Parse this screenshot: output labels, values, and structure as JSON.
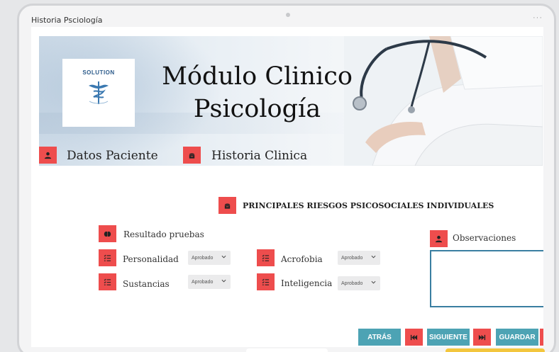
{
  "window": {
    "title": "Historia Psciología",
    "more": "···"
  },
  "banner": {
    "logo_text": "SOLUTION",
    "title_line1": "Módulo Clinico",
    "title_line2": "Psicología"
  },
  "nav": {
    "datos_paciente": "Datos Paciente",
    "historia_clinica": "Historia Clinica"
  },
  "section": {
    "title": "PRINCIPALES RIESGOS PSICOSOCIALES INDIVIDUALES"
  },
  "form": {
    "resultado_pruebas": "Resultado pruebas",
    "fields": [
      {
        "label": "Personalidad",
        "value": "Aprobado"
      },
      {
        "label": "Sustancias",
        "value": "Aprobado"
      },
      {
        "label": "Acrofobia",
        "value": "Aprobado"
      },
      {
        "label": "Inteligencia",
        "value": "Aprobado"
      }
    ],
    "observaciones": "Observaciones"
  },
  "buttons": {
    "atras": "ATRÁS",
    "siguiente": "SIGUIENTE",
    "guardar": "GUARDAR"
  },
  "colors": {
    "accent_red": "#ee4d4d",
    "teal": "#4da3b4",
    "border_blue": "#3a7ea1"
  }
}
